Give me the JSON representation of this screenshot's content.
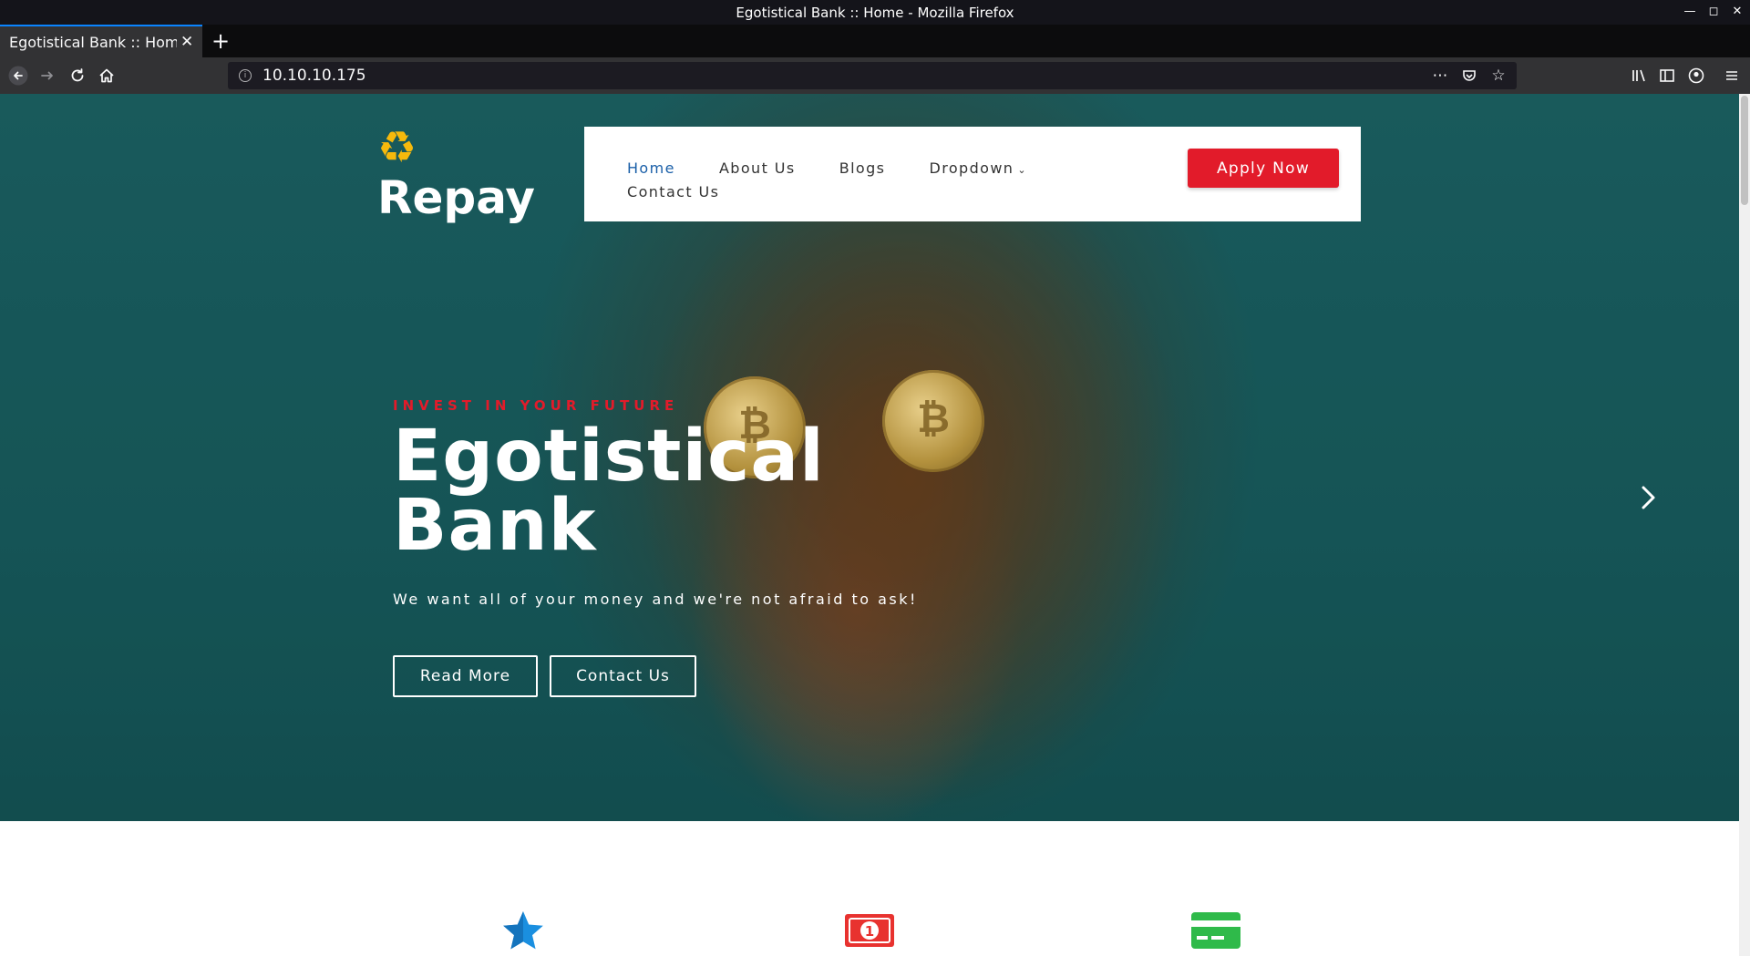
{
  "window": {
    "title": "Egotistical Bank :: Home - Mozilla Firefox"
  },
  "tabs": [
    {
      "label": "Egotistical Bank :: Home"
    }
  ],
  "urlbar": {
    "url": "10.10.10.175"
  },
  "site": {
    "logo_text": "Repay",
    "nav": {
      "home": "Home",
      "about": "About Us",
      "blogs": "Blogs",
      "dropdown": "Dropdown",
      "contact": "Contact Us"
    },
    "apply_label": "Apply Now"
  },
  "hero": {
    "kicker": "INVEST IN YOUR FUTURE",
    "title_line1": "Egotistical",
    "title_line2": "Bank",
    "subtitle": "We want all of your money and we're not afraid to ask!",
    "read_more": "Read More",
    "contact_us": "Contact Us"
  },
  "colors": {
    "accent_red": "#e21b2a",
    "nav_active": "#1a5fa8",
    "logo_yellow": "#f6b90c",
    "feature_blue": "#1a8fe0",
    "feature_red": "#e8322f",
    "feature_green": "#2fba4a"
  },
  "icons": {
    "feature_1": "star-icon",
    "feature_2": "banknote-icon",
    "feature_3": "credit-card-icon",
    "logo": "recycle-icon"
  }
}
